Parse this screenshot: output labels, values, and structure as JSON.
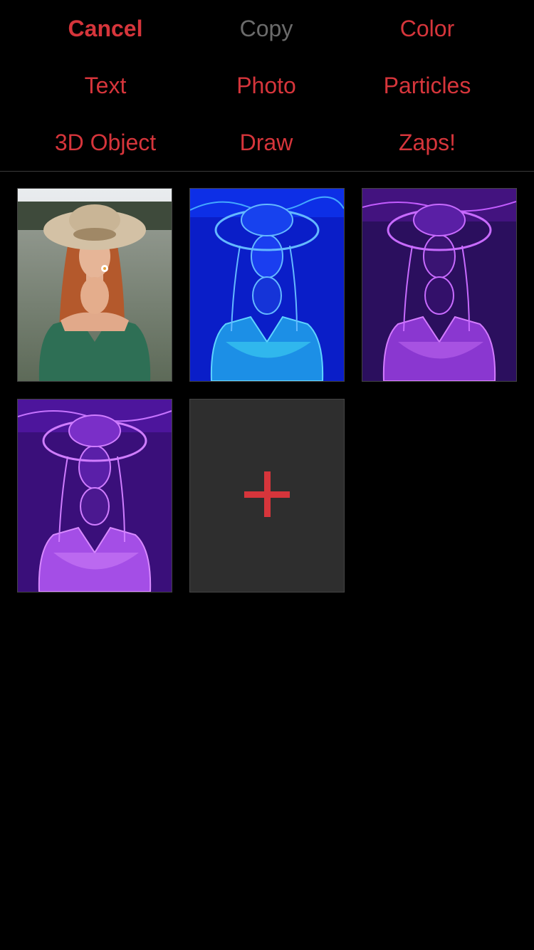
{
  "menu": {
    "cancel": "Cancel",
    "copy": "Copy",
    "color": "Color",
    "text": "Text",
    "photo": "Photo",
    "particles": "Particles",
    "object3d": "3D Object",
    "draw": "Draw",
    "zaps": "Zaps!"
  },
  "colors": {
    "accent": "#d6353b",
    "disabled": "#6b6b6b",
    "background": "#000000",
    "add_tile": "#2e2e2e"
  },
  "layers": [
    {
      "name": "original-photo",
      "style": "natural"
    },
    {
      "name": "blue-outline",
      "style": "neon-blue"
    },
    {
      "name": "purple-outline",
      "style": "neon-purple"
    },
    {
      "name": "violet-outline",
      "style": "neon-violet"
    }
  ],
  "add_tile_icon": "plus-icon"
}
